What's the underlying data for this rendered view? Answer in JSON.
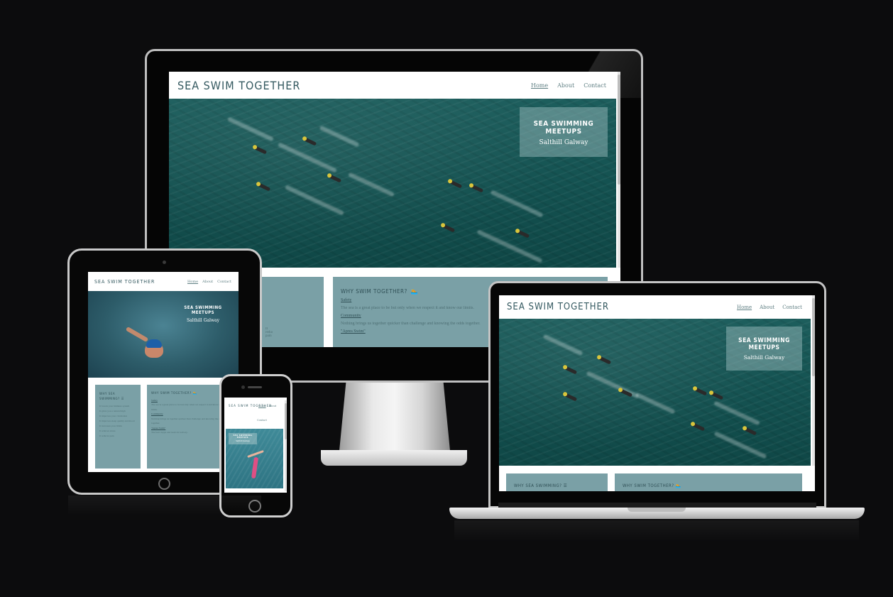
{
  "site": {
    "logo": "SEA SWIM TOGETHER",
    "nav": [
      "Home",
      "About",
      "Contact"
    ],
    "hero_title": "SEA SWIMMING MEETUPS",
    "hero_subtitle": "Salthill Galway"
  },
  "why_together": {
    "heading": "WHY SWIM TOGETHER?",
    "safety": "Safety",
    "safety_text": "The sea is a great place to be but only when we respect it and know our limits.",
    "community": "Community",
    "community_text": "Nothing brings us together quicker than challenge and knowing the odds together.",
    "after": "\"Apres Swim\"",
    "after_text": "The best cuppa and treats in Galway."
  },
  "why_swim": {
    "heading": "WHY SEA SWIMMING?",
    "items": [
      "It boosts your immune system",
      "It gives you a natural high",
      "It improves your circulation",
      "It improves sleep quality and mood",
      "It increases your libido",
      "It relieves stress",
      "It reduces pain"
    ]
  },
  "icons": {
    "menu": "hamburger-icon",
    "swimmer": "swimmer-icon"
  },
  "colors": {
    "background": "#0c0c0d",
    "brand": "#33585f",
    "panel": "#7aa0a6",
    "sea": "#145251"
  }
}
